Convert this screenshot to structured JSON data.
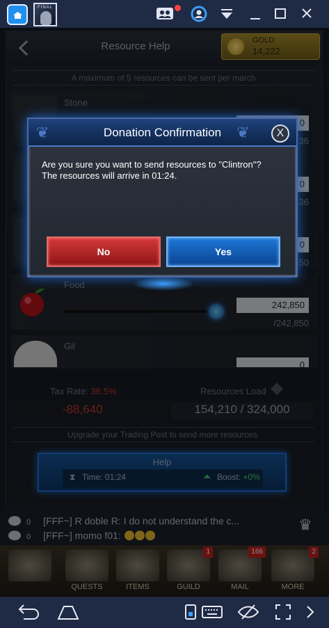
{
  "emulator": {
    "icons": {
      "home": "home-icon",
      "app": "game-app-thumbnail",
      "multi": "multi-instance-icon",
      "account": "account-icon",
      "menu": "dropdown-menu-icon",
      "minimize": "minimize-icon",
      "maximize": "maximize-icon",
      "close": "close-icon"
    },
    "app_label": "FINAL"
  },
  "header": {
    "title": "Resource Help",
    "gold_label": "GOLD",
    "gold_value": "14,222"
  },
  "notice": "A maximum of 5 resources can be sent per march",
  "resources": [
    {
      "name": "Stone",
      "amount": "0",
      "max": "36"
    },
    {
      "name": "",
      "amount": "0",
      "max": "36"
    },
    {
      "name": "",
      "amount": "0",
      "max": "50"
    },
    {
      "name": "Food",
      "amount": "242,850",
      "max": "/242,850"
    },
    {
      "name": "Gil",
      "amount": "0",
      "max": ""
    }
  ],
  "stats": {
    "tax_label": "Tax Rate:",
    "tax_value": "36.5%",
    "tax_amount": "-88,640",
    "load_label": "Resources Load",
    "load_value": "154,210 / 324,000"
  },
  "upgrade_notice": "Upgrade your Trading Post to send more resources.",
  "help_button": {
    "label": "Help",
    "time": "Time: 01:24",
    "boost_label": "Boost:",
    "boost_value": "+0%"
  },
  "chat": [
    {
      "count": "0",
      "text": "[FFF~] R doble R: I do not understand the c..."
    },
    {
      "count": "0",
      "text": "[FFF~] momo f01: "
    }
  ],
  "nav": [
    {
      "label": "",
      "badge": ""
    },
    {
      "label": "QUESTS",
      "badge": ""
    },
    {
      "label": "ITEMS",
      "badge": ""
    },
    {
      "label": "GUILD",
      "badge": "1"
    },
    {
      "label": "MAIL",
      "badge": "166"
    },
    {
      "label": "MORE",
      "badge": "2"
    }
  ],
  "dialog": {
    "title": "Donation Confirmation",
    "close": "X",
    "line1": "Are you sure you want to send resources to \"Clintron\"?",
    "line2": "The resources will arrive in 01:24.",
    "no_label": "No",
    "yes_label": "Yes"
  },
  "colors": {
    "dialog_header": "#13305d",
    "no_button": "#c62e2e",
    "yes_button": "#1b6fcf",
    "tax_red": "#c0392b"
  }
}
